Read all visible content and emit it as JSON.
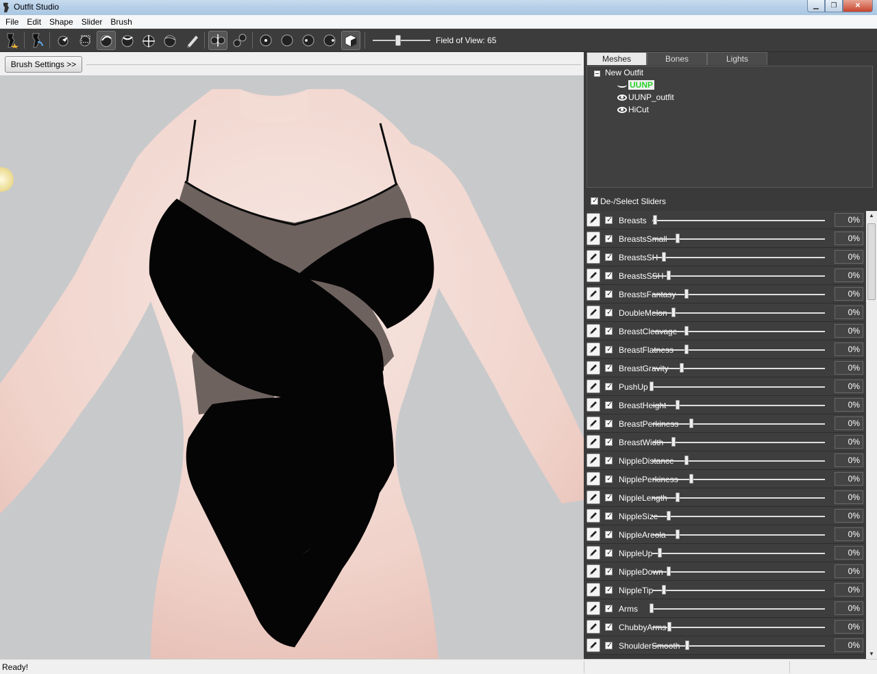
{
  "window": {
    "title": "Outfit Studio"
  },
  "menu": [
    "File",
    "Edit",
    "Shape",
    "Slider",
    "Brush"
  ],
  "toolbar": {
    "fov_label": "Field of View: 65",
    "fov_value": 65
  },
  "brush_settings_label": "Brush Settings >>",
  "panel": {
    "tabs": [
      "Meshes",
      "Bones",
      "Lights"
    ],
    "active_tab": "Meshes",
    "tree": {
      "root": "New Outfit",
      "items": [
        {
          "label": "UUNP",
          "selected": true
        },
        {
          "label": "UUNP_outfit",
          "selected": false
        },
        {
          "label": "HiCut",
          "selected": false
        }
      ]
    }
  },
  "sliders_header": "De-/Select Sliders",
  "sliders": [
    {
      "name": "Breasts",
      "value": "0%",
      "pos": 0.0
    },
    {
      "name": "BreastsSmall",
      "value": "0%",
      "pos": 0.13
    },
    {
      "name": "BreastsSH",
      "value": "0%",
      "pos": 0.06
    },
    {
      "name": "BreastsSSH",
      "value": "0%",
      "pos": 0.09
    },
    {
      "name": "BreastsFantasy",
      "value": "0%",
      "pos": 0.18
    },
    {
      "name": "DoubleMelon",
      "value": "0%",
      "pos": 0.16
    },
    {
      "name": "BreastCleavage",
      "value": "0%",
      "pos": 0.19
    },
    {
      "name": "BreastFlatness",
      "value": "0%",
      "pos": 0.17
    },
    {
      "name": "BreastGravity",
      "value": "0%",
      "pos": 0.15
    },
    {
      "name": "PushUp",
      "value": "0%",
      "pos": 0.02
    },
    {
      "name": "BreastHeight",
      "value": "0%",
      "pos": 0.14
    },
    {
      "name": "BreastPerkiness",
      "value": "0%",
      "pos": 0.2
    },
    {
      "name": "BreastWidth",
      "value": "0%",
      "pos": 0.12
    },
    {
      "name": "NippleDistance",
      "value": "0%",
      "pos": 0.19
    },
    {
      "name": "NipplePerkiness",
      "value": "0%",
      "pos": 0.21
    },
    {
      "name": "NippleLength",
      "value": "0%",
      "pos": 0.15
    },
    {
      "name": "NippleSize",
      "value": "0%",
      "pos": 0.07
    },
    {
      "name": "NippleAreola",
      "value": "0%",
      "pos": 0.14
    },
    {
      "name": "NippleUp",
      "value": "0%",
      "pos": 0.06
    },
    {
      "name": "NippleDown",
      "value": "0%",
      "pos": 0.13
    },
    {
      "name": "NippleTip",
      "value": "0%",
      "pos": 0.06
    },
    {
      "name": "Arms",
      "value": "0%",
      "pos": -0.04
    },
    {
      "name": "ChubbyArms",
      "value": "0%",
      "pos": 0.15
    },
    {
      "name": "ShoulderSmooth",
      "value": "0%",
      "pos": 0.24
    }
  ],
  "status": {
    "text": "Ready!"
  }
}
